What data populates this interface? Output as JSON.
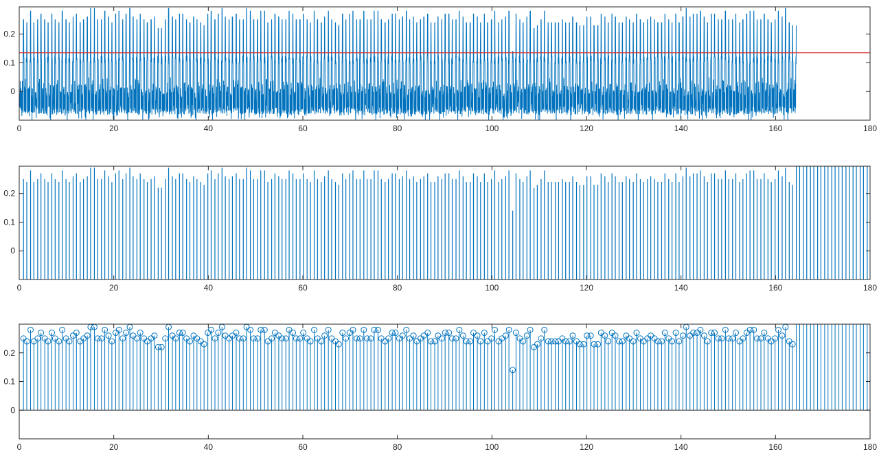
{
  "chart_data": [
    {
      "type": "line",
      "title": "",
      "xlabel": "",
      "ylabel": "",
      "xlim": [
        0,
        180
      ],
      "ylim": [
        -0.1,
        0.295
      ],
      "xticks": [
        0,
        20,
        40,
        60,
        80,
        100,
        120,
        140,
        160,
        180
      ],
      "yticks": [
        0,
        0.1,
        0.2
      ],
      "xtick_labels": [
        "0",
        "20",
        "40",
        "60",
        "80",
        "100",
        "120",
        "140",
        "160",
        "180"
      ],
      "ytick_labels": [
        "0",
        "0.1",
        "0.2"
      ],
      "grid": false,
      "threshold": 0.135,
      "colors": {
        "series": "#0072BD",
        "threshold": "#D62728"
      },
      "description_of_series": "ECG-like signal with periodic R peaks (~0.22-0.29) riding on a baseline oscillating roughly between -0.07 and 0.03"
    },
    {
      "type": "line",
      "title": "",
      "xlabel": "",
      "ylabel": "",
      "xlim": [
        0,
        180
      ],
      "ylim": [
        -0.1,
        0.295
      ],
      "xticks": [
        0,
        20,
        40,
        60,
        80,
        100,
        120,
        140,
        160,
        180
      ],
      "yticks": [
        0,
        0.1,
        0.2
      ],
      "xtick_labels": [
        "0",
        "20",
        "40",
        "60",
        "80",
        "100",
        "120",
        "140",
        "160",
        "180"
      ],
      "ytick_labels": [
        "0",
        "0.1",
        "0.2"
      ],
      "grid": false,
      "colors": {
        "series": "#0072BD"
      }
    },
    {
      "type": "stem",
      "title": "",
      "xlabel": "",
      "ylabel": "",
      "xlim": [
        0,
        180
      ],
      "ylim": [
        -0.1,
        0.3
      ],
      "xticks": [
        0,
        20,
        40,
        60,
        80,
        100,
        120,
        140,
        160,
        180
      ],
      "yticks": [
        0,
        0.1,
        0.2
      ],
      "xtick_labels": [
        "0",
        "20",
        "40",
        "60",
        "80",
        "100",
        "120",
        "140",
        "160",
        "180"
      ],
      "ytick_labels": [
        "0",
        "0.1",
        "0.2"
      ],
      "grid": false,
      "colors": {
        "series": "#0072BD"
      },
      "peaks": {
        "x": [
          0.9,
          1.6,
          2.4,
          3.1,
          3.9,
          4.6,
          5.4,
          6.1,
          6.9,
          7.6,
          8.4,
          9.1,
          9.9,
          10.6,
          11.4,
          12.1,
          12.9,
          13.6,
          14.4,
          15.1,
          15.9,
          16.6,
          17.4,
          18.1,
          18.9,
          19.6,
          20.4,
          21.1,
          21.9,
          22.6,
          23.4,
          24.1,
          24.9,
          25.6,
          26.4,
          27.1,
          27.9,
          28.6,
          29.4,
          30.1,
          30.9,
          31.6,
          32.4,
          33.1,
          33.9,
          34.6,
          35.4,
          36.1,
          36.9,
          37.6,
          38.4,
          39.1,
          39.9,
          40.6,
          41.4,
          42.1,
          42.9,
          43.6,
          44.4,
          45.1,
          45.9,
          46.6,
          47.4,
          48.1,
          48.9,
          49.6,
          50.4,
          51.1,
          51.9,
          52.6,
          53.4,
          54.1,
          54.9,
          55.6,
          56.4,
          57.1,
          57.9,
          58.6,
          59.4,
          60.1,
          60.9,
          61.6,
          62.4,
          63.1,
          63.9,
          64.6,
          65.4,
          66.1,
          66.9,
          67.6,
          68.4,
          69.1,
          69.9,
          70.6,
          71.4,
          72.1,
          72.9,
          73.6,
          74.4,
          75.1,
          75.9,
          76.6,
          77.4,
          78.1,
          78.9,
          79.6,
          80.4,
          81.1,
          81.9,
          82.6,
          83.4,
          84.1,
          84.9,
          85.6,
          86.4,
          87.1,
          87.9,
          88.6,
          89.4,
          90.1,
          90.9,
          91.6,
          92.4,
          93.1,
          93.9,
          94.6,
          95.4,
          96.1,
          96.9,
          97.6,
          98.4,
          99.1,
          99.9,
          100.6,
          101.4,
          102.1,
          102.9,
          103.6,
          104.4,
          105.1,
          105.9,
          106.6,
          107.4,
          108.1,
          108.9,
          109.6,
          110.4,
          111.1,
          111.9,
          112.6,
          113.4,
          114.1,
          114.9,
          115.6,
          116.4,
          117.1,
          117.9,
          118.6,
          119.4,
          120.1,
          120.9,
          121.6,
          122.4,
          123.1,
          123.9,
          124.6,
          125.4,
          126.1,
          126.9,
          127.6,
          128.4,
          129.1,
          129.9,
          130.6,
          131.4,
          132.1,
          132.9,
          133.6,
          134.4,
          135.1,
          135.9,
          136.6,
          137.4,
          138.1,
          138.9,
          139.6,
          140.4,
          141.1,
          141.9,
          142.6,
          143.4,
          144.1,
          144.9,
          145.6,
          146.4,
          147.1,
          147.9,
          148.6,
          149.4,
          150.1,
          150.9,
          151.6,
          152.4,
          153.1,
          153.9,
          154.6,
          155.4,
          156.1,
          156.9,
          157.6,
          158.4,
          159.1,
          159.9,
          160.6,
          161.4,
          162.1,
          162.9,
          163.6,
          164.4,
          165.1,
          165.9,
          166.6,
          167.4,
          168.1,
          168.9,
          169.6,
          170.4,
          171.1,
          171.9,
          172.6,
          173.4,
          174.1,
          174.9,
          175.6,
          176.4,
          177.1,
          177.9,
          178.6,
          179.4
        ],
        "y": [
          0.25,
          0.24,
          0.28,
          0.24,
          0.25,
          0.27,
          0.25,
          0.24,
          0.27,
          0.25,
          0.24,
          0.28,
          0.25,
          0.24,
          0.26,
          0.27,
          0.24,
          0.25,
          0.26,
          0.29,
          0.29,
          0.25,
          0.25,
          0.28,
          0.26,
          0.24,
          0.27,
          0.28,
          0.25,
          0.27,
          0.29,
          0.26,
          0.25,
          0.27,
          0.25,
          0.24,
          0.25,
          0.26,
          0.22,
          0.22,
          0.25,
          0.29,
          0.26,
          0.25,
          0.27,
          0.27,
          0.25,
          0.24,
          0.26,
          0.25,
          0.24,
          0.23,
          0.27,
          0.28,
          0.25,
          0.27,
          0.29,
          0.26,
          0.25,
          0.26,
          0.27,
          0.25,
          0.25,
          0.29,
          0.28,
          0.25,
          0.25,
          0.28,
          0.28,
          0.24,
          0.25,
          0.27,
          0.26,
          0.25,
          0.25,
          0.28,
          0.27,
          0.25,
          0.25,
          0.27,
          0.25,
          0.24,
          0.28,
          0.25,
          0.24,
          0.26,
          0.28,
          0.25,
          0.24,
          0.23,
          0.27,
          0.25,
          0.27,
          0.28,
          0.25,
          0.25,
          0.28,
          0.25,
          0.25,
          0.28,
          0.28,
          0.25,
          0.24,
          0.25,
          0.27,
          0.27,
          0.25,
          0.26,
          0.28,
          0.25,
          0.26,
          0.24,
          0.25,
          0.26,
          0.27,
          0.24,
          0.24,
          0.26,
          0.25,
          0.27,
          0.27,
          0.25,
          0.25,
          0.28,
          0.26,
          0.24,
          0.24,
          0.27,
          0.26,
          0.24,
          0.27,
          0.24,
          0.25,
          0.28,
          0.24,
          0.25,
          0.26,
          0.28,
          0.14,
          0.27,
          0.25,
          0.24,
          0.26,
          0.28,
          0.22,
          0.23,
          0.25,
          0.28,
          0.24,
          0.24,
          0.24,
          0.24,
          0.25,
          0.24,
          0.24,
          0.26,
          0.24,
          0.23,
          0.23,
          0.26,
          0.26,
          0.23,
          0.23,
          0.27,
          0.26,
          0.24,
          0.27,
          0.26,
          0.24,
          0.24,
          0.26,
          0.25,
          0.24,
          0.27,
          0.25,
          0.24,
          0.25,
          0.26,
          0.25,
          0.24,
          0.24,
          0.27,
          0.25,
          0.24,
          0.27,
          0.24,
          0.26,
          0.29,
          0.26,
          0.27,
          0.27,
          0.28,
          0.26,
          0.24,
          0.27,
          0.27,
          0.25,
          0.25,
          0.28,
          0.25,
          0.25,
          0.27,
          0.24,
          0.25,
          0.27,
          0.28,
          0.28,
          0.25,
          0.25,
          0.27,
          0.25,
          0.24,
          0.25,
          0.28,
          0.26,
          0.29,
          0.24,
          0.23
        ]
      }
    }
  ]
}
